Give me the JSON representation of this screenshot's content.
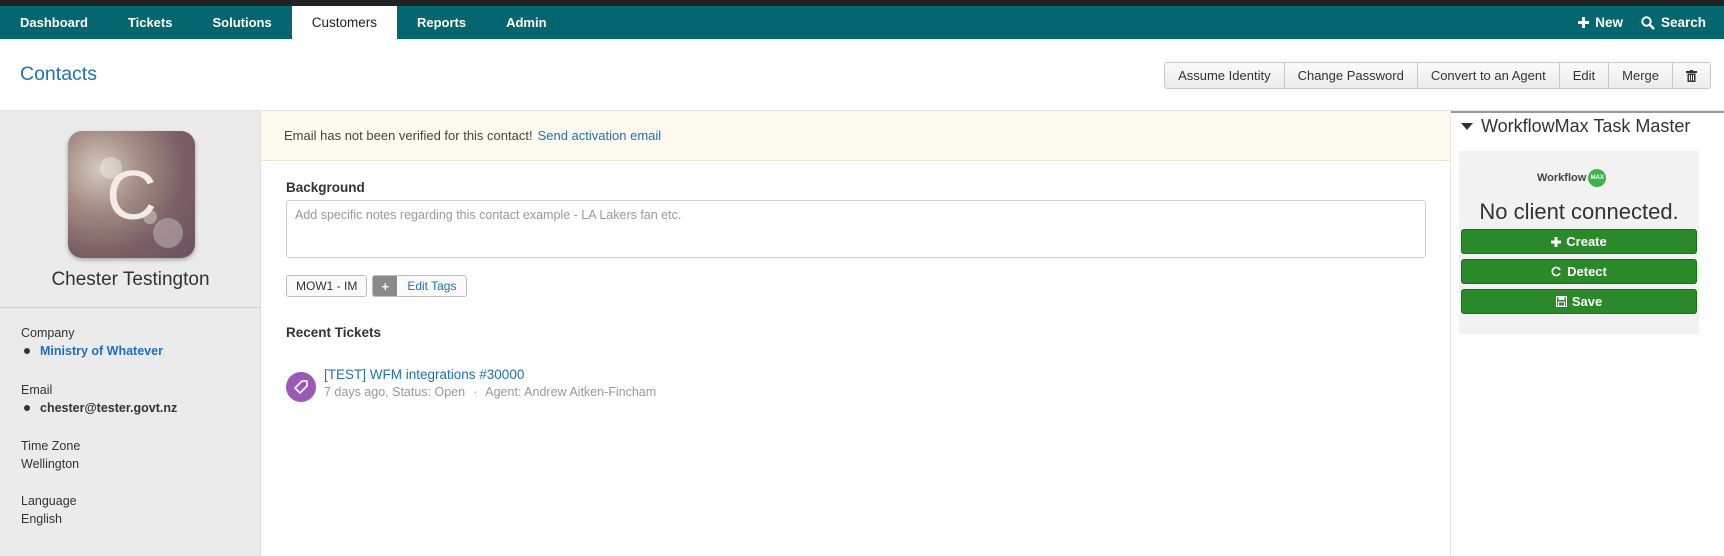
{
  "nav": {
    "tabs": [
      {
        "label": "Dashboard"
      },
      {
        "label": "Tickets"
      },
      {
        "label": "Solutions"
      },
      {
        "label": "Customers"
      },
      {
        "label": "Reports"
      },
      {
        "label": "Admin"
      }
    ],
    "active_tab": "Customers",
    "new_label": "New",
    "search_label": "Search"
  },
  "header": {
    "title": "Contacts",
    "actions": [
      "Assume Identity",
      "Change Password",
      "Convert to an Agent",
      "Edit",
      "Merge"
    ]
  },
  "contact": {
    "avatar_letter": "C",
    "name": "Chester Testington",
    "company_label": "Company",
    "company": "Ministry of Whatever",
    "email_label": "Email",
    "email": "chester@tester.govt.nz",
    "timezone_label": "Time Zone",
    "timezone": "Wellington",
    "language_label": "Language",
    "language": "English"
  },
  "alert": {
    "text": "Email has not been verified for this contact!",
    "link": "Send activation email"
  },
  "background": {
    "label": "Background",
    "placeholder": "Add specific notes regarding this contact example - LA Lakers fan etc."
  },
  "tags": {
    "items": [
      "MOW1 - IM"
    ],
    "edit_label": "Edit Tags"
  },
  "recent_tickets": {
    "label": "Recent Tickets",
    "items": [
      {
        "title": "[TEST] WFM integrations #30000",
        "meta": "7 days ago, Status: Open",
        "agent": "Agent: Andrew Aitken-Fincham"
      }
    ]
  },
  "workflowmax": {
    "title": "WorkflowMax Task Master",
    "logo_text": "Workflow",
    "logo_badge": "MAX",
    "message": "No client connected.",
    "buttons": [
      "Create",
      "Detect",
      "Save"
    ],
    "button_color": "#2a8a2a"
  },
  "colors": {
    "nav_bg": "#04676f",
    "link": "#1f6fbf",
    "ticket_icon": "#9b59b6"
  }
}
